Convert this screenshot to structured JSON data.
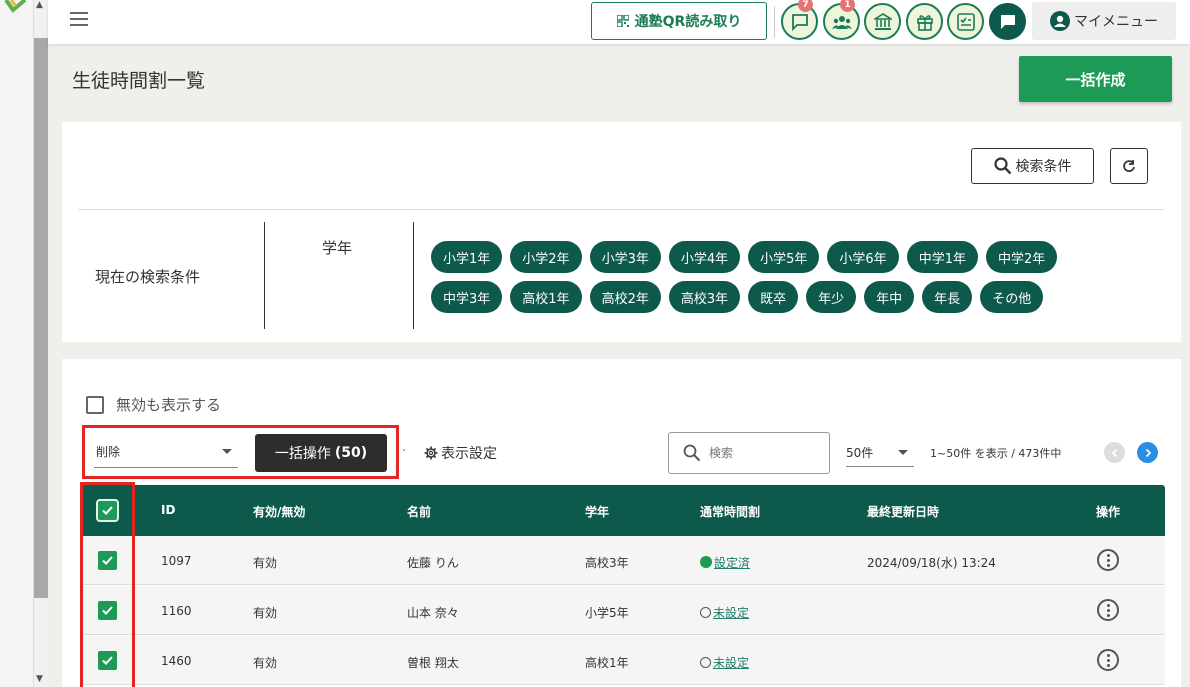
{
  "header": {
    "qr_label": "通塾QR読み取り",
    "badges": {
      "messages": "7",
      "students": "1"
    },
    "my_menu": "マイメニュー"
  },
  "page": {
    "title": "生徒時間割一覧",
    "bulk_create": "一括作成"
  },
  "search": {
    "conditions_button": "検索条件",
    "current_label": "現在の検索条件",
    "grade_label": "学年",
    "chips": [
      "小学1年",
      "小学2年",
      "小学3年",
      "小学4年",
      "小学5年",
      "小学6年",
      "中学1年",
      "中学2年",
      "中学3年",
      "高校1年",
      "高校2年",
      "高校3年",
      "既卒",
      "年少",
      "年中",
      "年長",
      "その他"
    ]
  },
  "list": {
    "show_invalid": "無効も表示する",
    "operation_value": "削除",
    "bulk_operation": "一括操作",
    "bulk_count": "(50)",
    "display_settings": "表示設定",
    "search_placeholder": "検索",
    "per_page": "50件",
    "range": "1~50件 を表示 / 473件中",
    "columns": [
      "ID",
      "有効/無効",
      "名前",
      "学年",
      "通常時間割",
      "最終更新日時",
      "操作"
    ],
    "rows": [
      {
        "id": "1097",
        "status": "有効",
        "name": "佐藤 りん",
        "grade": "高校3年",
        "schedule": "設定済",
        "schedule_set": true,
        "updated": "2024/09/18(水) 13:24"
      },
      {
        "id": "1160",
        "status": "有効",
        "name": "山本 奈々",
        "grade": "小学5年",
        "schedule": "未設定",
        "schedule_set": false,
        "updated": ""
      },
      {
        "id": "1460",
        "status": "有効",
        "name": "曽根 翔太",
        "grade": "高校1年",
        "schedule": "未設定",
        "schedule_set": false,
        "updated": ""
      }
    ]
  },
  "colors": {
    "primary_dark": "#0d5a4d",
    "primary_green": "#1d9a55",
    "highlight_red": "#e52521",
    "link_blue": "#2a8de6"
  }
}
